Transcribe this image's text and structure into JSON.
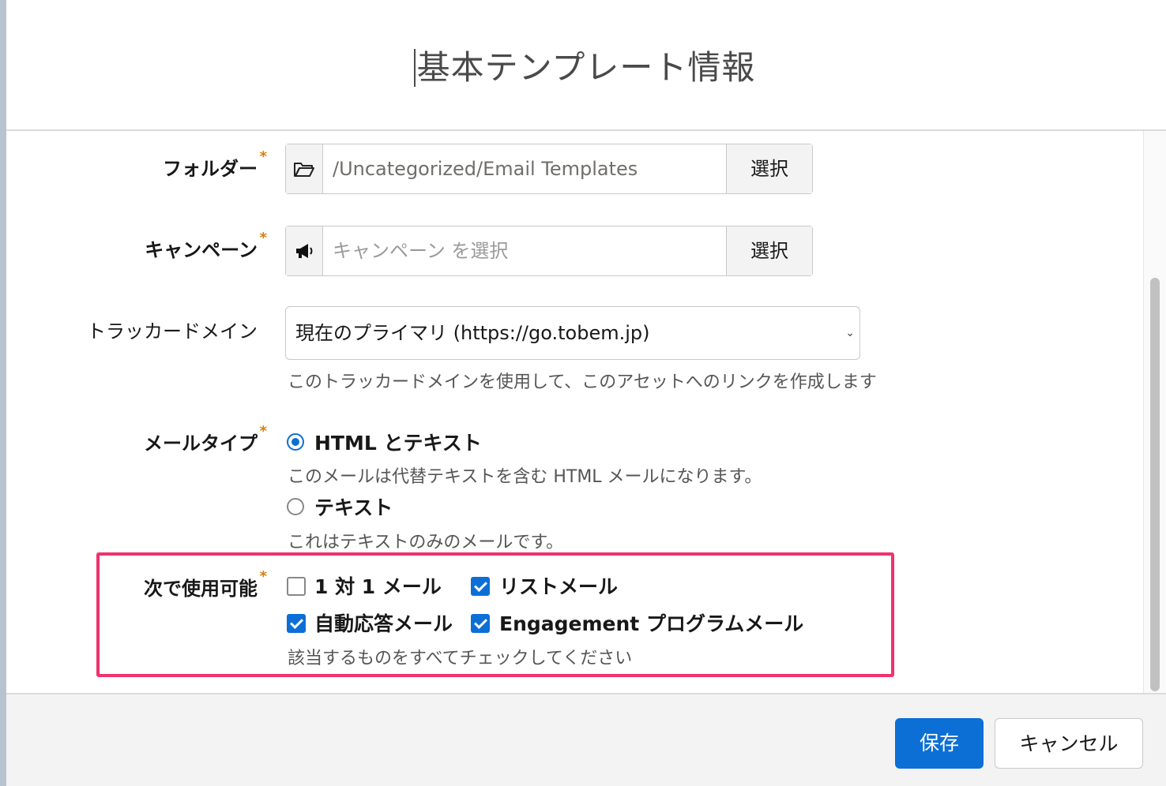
{
  "modal": {
    "title": "基本テンプレート情報"
  },
  "fields": {
    "folder": {
      "label": "フォルダー",
      "required": "*",
      "value": "/Uncategorized/Email Templates",
      "select_label": "選択",
      "icon": "folder-open-icon"
    },
    "campaign": {
      "label": "キャンペーン",
      "required": "*",
      "placeholder": "キャンペーン を選択",
      "select_label": "選択",
      "icon": "megaphone-icon"
    },
    "tracker_domain": {
      "label": "トラッカードメイン",
      "selected": "現在のプライマリ (https://go.tobem.jp)",
      "help": "このトラッカードメインを使用して、このアセットへのリンクを作成します"
    },
    "email_type": {
      "label": "メールタイプ",
      "required": "*",
      "options": [
        {
          "label": "HTML とテキスト",
          "help": "このメールは代替テキストを含む HTML メールになります。",
          "selected": true
        },
        {
          "label": "テキスト",
          "help": "これはテキストのみのメールです。",
          "selected": false
        }
      ]
    },
    "available_for": {
      "label": "次で使用可能",
      "required": "*",
      "options": [
        {
          "label": "1 対 1 メール",
          "checked": false
        },
        {
          "label": "リストメール",
          "checked": true
        },
        {
          "label": "自動応答メール",
          "checked": true
        },
        {
          "label": "Engagement プログラムメール",
          "checked": true
        }
      ],
      "help": "該当するものをすべてチェックしてください"
    }
  },
  "footer": {
    "save_label": "保存",
    "cancel_label": "キャンセル"
  },
  "colors": {
    "accent": "#0b6fd6",
    "highlight": "#f0326f",
    "required": "#e07b00"
  }
}
